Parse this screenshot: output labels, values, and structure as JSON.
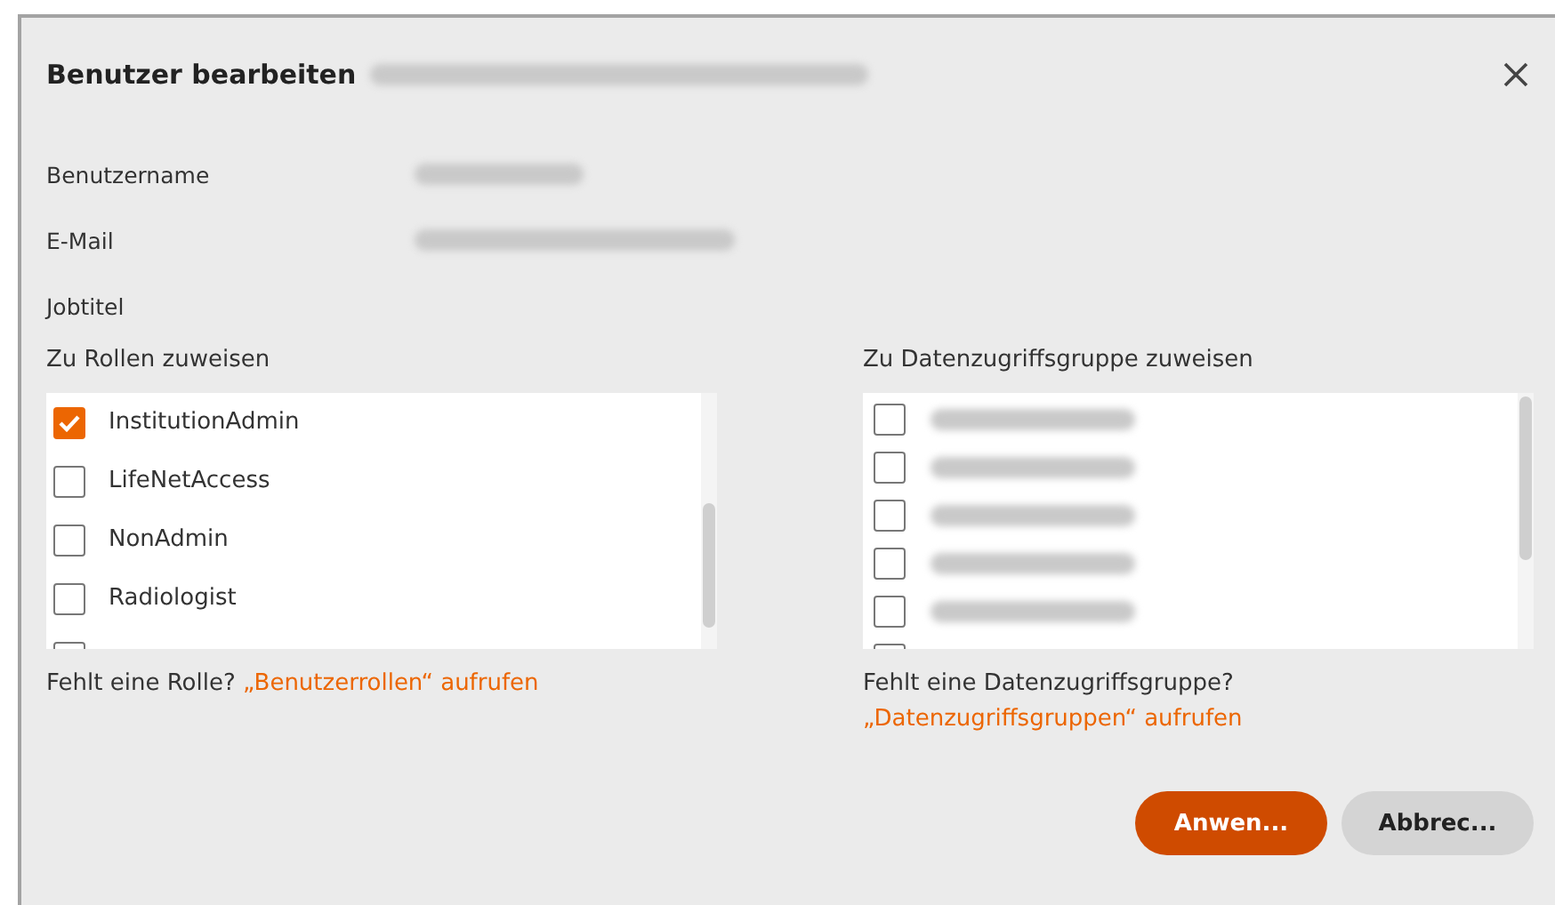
{
  "dialog": {
    "title": "Benutzer bearbeiten",
    "title_redacted": true
  },
  "fields": [
    {
      "label": "Benutzername",
      "redacted": true
    },
    {
      "label": "E-Mail",
      "redacted": true
    },
    {
      "label": "Jobtitel",
      "redacted": false
    }
  ],
  "roles": {
    "heading": "Zu Rollen zuweisen",
    "items": [
      {
        "label": "InstitutionAdmin",
        "checked": true
      },
      {
        "label": "LifeNetAccess",
        "checked": false
      },
      {
        "label": "NonAdmin",
        "checked": false
      },
      {
        "label": "Radiologist",
        "checked": false
      },
      {
        "checked": false
      }
    ],
    "hint": "Fehlt eine Rolle?",
    "link": "„Benutzerrollen“ aufrufen"
  },
  "groups": {
    "heading": "Zu Datenzugriffsgruppe zuweisen",
    "items": [
      {
        "checked": false
      },
      {
        "checked": false
      },
      {
        "checked": false
      },
      {
        "checked": false
      },
      {
        "checked": false
      },
      {
        "checked": false
      }
    ],
    "hint": "Fehlt eine Datenzugriffsgruppe?",
    "link": "„Datenzugriffsgruppen“ aufrufen"
  },
  "buttons": [
    {
      "label": "Anwen...",
      "kind": "primary"
    },
    {
      "label": "Abbrec...",
      "kind": "secondary"
    }
  ]
}
